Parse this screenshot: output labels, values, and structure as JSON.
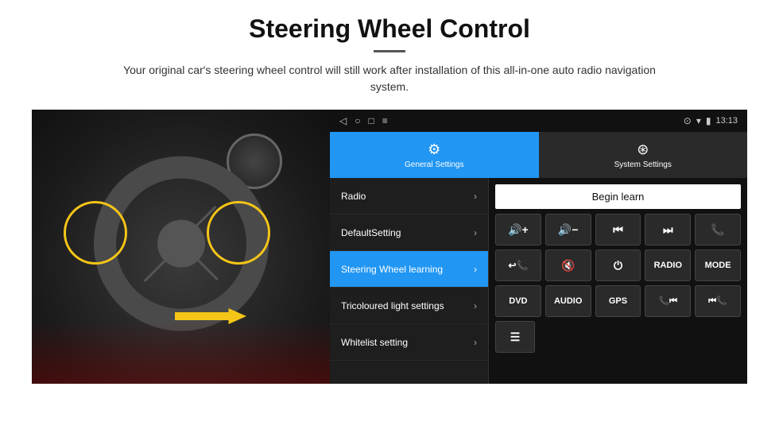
{
  "header": {
    "title": "Steering Wheel Control",
    "subtitle": "Your original car's steering wheel control will still work after installation of this all-in-one auto radio navigation system."
  },
  "status_bar": {
    "time": "13:13",
    "icons_left": [
      "◁",
      "○",
      "□",
      "≡"
    ],
    "icons_right": [
      "⊙",
      "▾",
      "🔋"
    ]
  },
  "tabs": [
    {
      "id": "general",
      "label": "General Settings",
      "icon": "⚙",
      "active": true
    },
    {
      "id": "system",
      "label": "System Settings",
      "icon": "⊕",
      "active": false
    }
  ],
  "menu_items": [
    {
      "id": "radio",
      "label": "Radio",
      "active": false
    },
    {
      "id": "default",
      "label": "DefaultSetting",
      "active": false
    },
    {
      "id": "steering",
      "label": "Steering Wheel learning",
      "active": true
    },
    {
      "id": "tricolour",
      "label": "Tricoloured light settings",
      "active": false
    },
    {
      "id": "whitelist",
      "label": "Whitelist setting",
      "active": false
    }
  ],
  "right_panel": {
    "begin_learn_label": "Begin learn",
    "control_rows": [
      [
        {
          "icon": "🔊+",
          "label": "vol-up"
        },
        {
          "icon": "🔊−",
          "label": "vol-down"
        },
        {
          "icon": "⏮",
          "label": "prev"
        },
        {
          "icon": "⏭",
          "label": "next"
        },
        {
          "icon": "📞",
          "label": "call"
        }
      ],
      [
        {
          "icon": "📞↩",
          "label": "hangup"
        },
        {
          "icon": "🔇",
          "label": "mute"
        },
        {
          "icon": "⏻",
          "label": "power"
        },
        {
          "icon": "RADIO",
          "label": "radio"
        },
        {
          "icon": "MODE",
          "label": "mode"
        }
      ],
      [
        {
          "icon": "DVD",
          "label": "dvd"
        },
        {
          "icon": "AUDIO",
          "label": "audio"
        },
        {
          "icon": "GPS",
          "label": "gps"
        },
        {
          "icon": "📞⏮",
          "label": "call-prev"
        },
        {
          "icon": "⏮📞",
          "label": "prev-call"
        }
      ]
    ],
    "bottom_icon": "≡"
  }
}
